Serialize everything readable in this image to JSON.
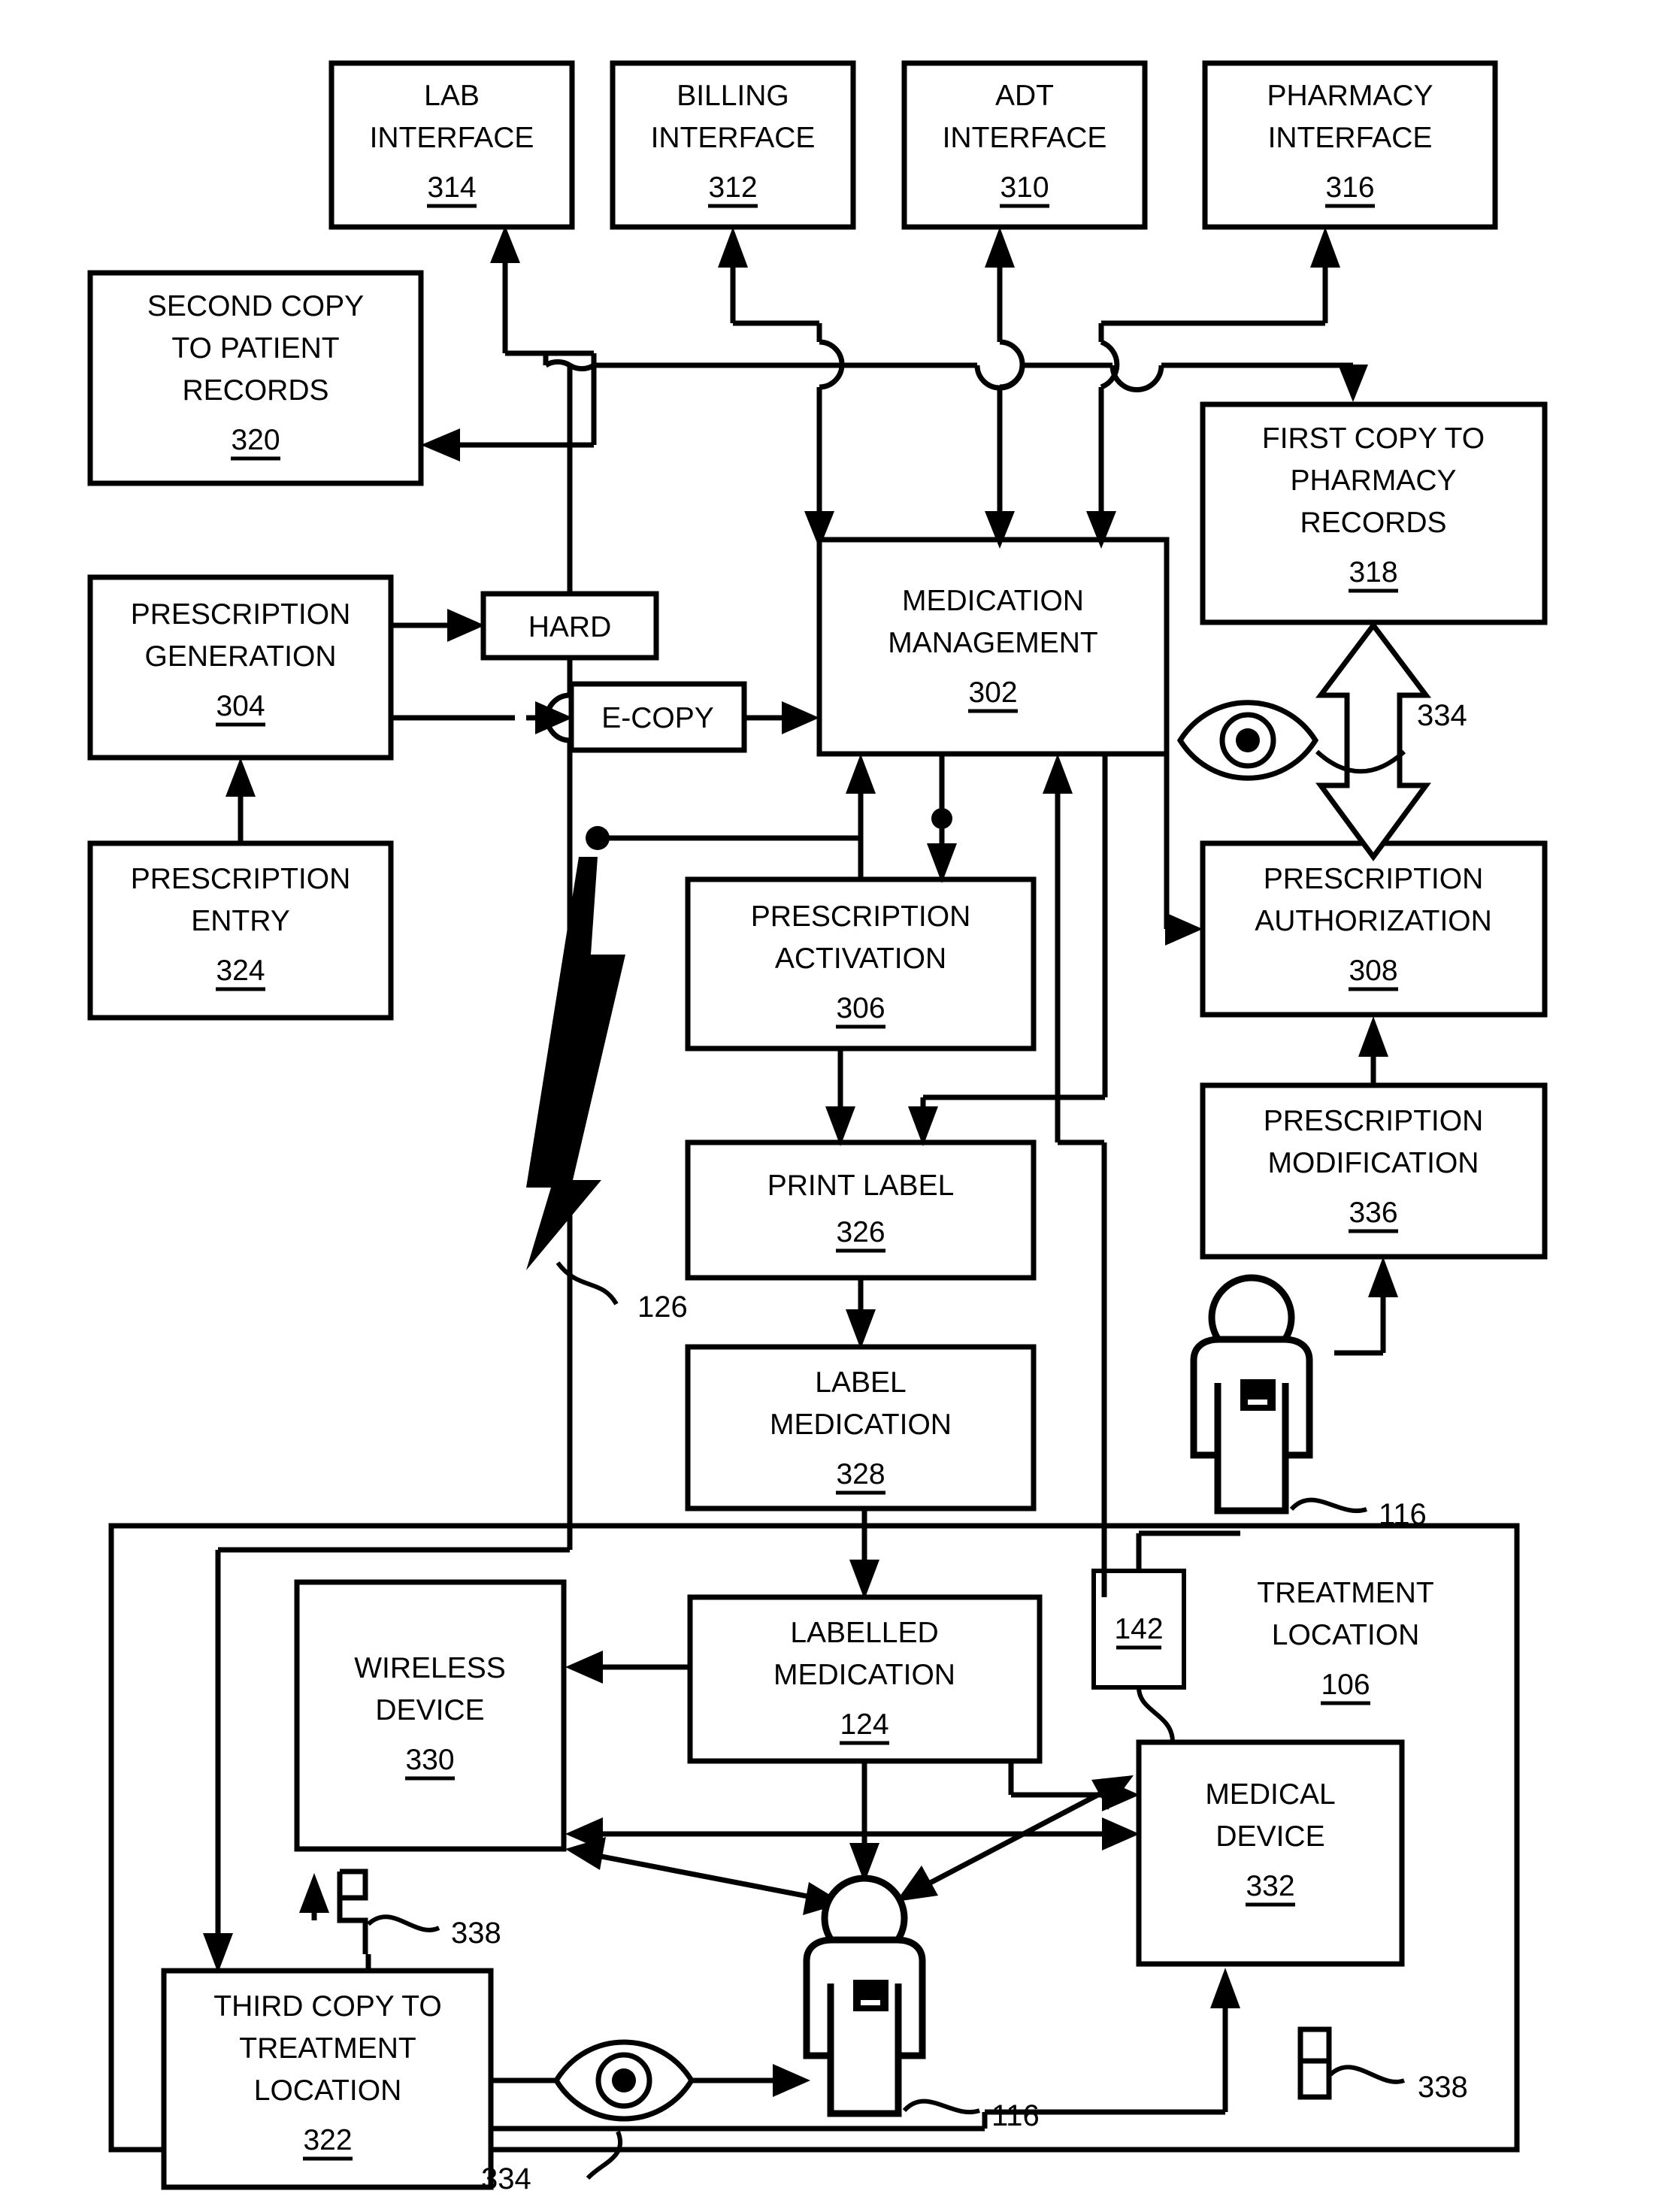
{
  "figure": {
    "type": "patent-flow-diagram",
    "title": "Medication management workflow"
  },
  "boxes": {
    "lab_interface": {
      "line1": "LAB",
      "line2": "INTERFACE",
      "ref": "314"
    },
    "billing_interface": {
      "line1": "BILLING",
      "line2": "INTERFACE",
      "ref": "312"
    },
    "adt_interface": {
      "line1": "ADT",
      "line2": "INTERFACE",
      "ref": "310"
    },
    "pharmacy_interface": {
      "line1": "PHARMACY",
      "line2": "INTERFACE",
      "ref": "316"
    },
    "second_copy": {
      "line1": "SECOND COPY",
      "line2": "TO PATIENT",
      "line3": "RECORDS",
      "ref": "320"
    },
    "first_copy": {
      "line1": "FIRST COPY TO",
      "line2": "PHARMACY",
      "line3": "RECORDS",
      "ref": "318"
    },
    "prescription_generation": {
      "line1": "PRESCRIPTION",
      "line2": "GENERATION",
      "ref": "304"
    },
    "hard": {
      "line1": "HARD"
    },
    "ecopy": {
      "line1": "E-COPY"
    },
    "medication_management": {
      "line1": "MEDICATION",
      "line2": "MANAGEMENT",
      "ref": "302"
    },
    "prescription_entry": {
      "line1": "PRESCRIPTION",
      "line2": "ENTRY",
      "ref": "324"
    },
    "prescription_activation": {
      "line1": "PRESCRIPTION",
      "line2": "ACTIVATION",
      "ref": "306"
    },
    "prescription_authorization": {
      "line1": "PRESCRIPTION",
      "line2": "AUTHORIZATION",
      "ref": "308"
    },
    "prescription_modification": {
      "line1": "PRESCRIPTION",
      "line2": "MODIFICATION",
      "ref": "336"
    },
    "print_label": {
      "line1": "PRINT LABEL",
      "ref": "326"
    },
    "label_medication": {
      "line1": "LABEL",
      "line2": "MEDICATION",
      "ref": "328"
    },
    "labelled_medication": {
      "line1": "LABELLED",
      "line2": "MEDICATION",
      "ref": "124"
    },
    "wireless_device": {
      "line1": "WIRELESS",
      "line2": "DEVICE",
      "ref": "330"
    },
    "medical_device": {
      "line1": "MEDICAL",
      "line2": "DEVICE",
      "ref": "332"
    },
    "third_copy": {
      "line1": "THIRD COPY TO",
      "line2": "TREATMENT",
      "line3": "LOCATION",
      "ref": "322"
    },
    "tag_142": {
      "ref": "142"
    },
    "treatment_location": {
      "line1": "TREATMENT",
      "line2": "LOCATION",
      "ref": "106"
    }
  },
  "reference_numerals": {
    "eye_upper": "334",
    "eye_lower": "334",
    "lightning": "126",
    "patient_upper": "116",
    "patient_lower": "116",
    "scanner_left": "338",
    "scanner_right": "338"
  },
  "icons": {
    "eye_upper": "eye-icon",
    "eye_lower": "eye-icon",
    "patient_upper": "patient-figure-icon",
    "patient_lower": "patient-figure-icon",
    "lightning": "lightning-bolt-icon",
    "scanner_left": "barcode-scanner-icon",
    "scanner_right": "barcode-scanner-icon",
    "double_arrow": "double-headed-arrow-icon"
  },
  "colors": {
    "line": "#000000",
    "background": "#ffffff"
  }
}
